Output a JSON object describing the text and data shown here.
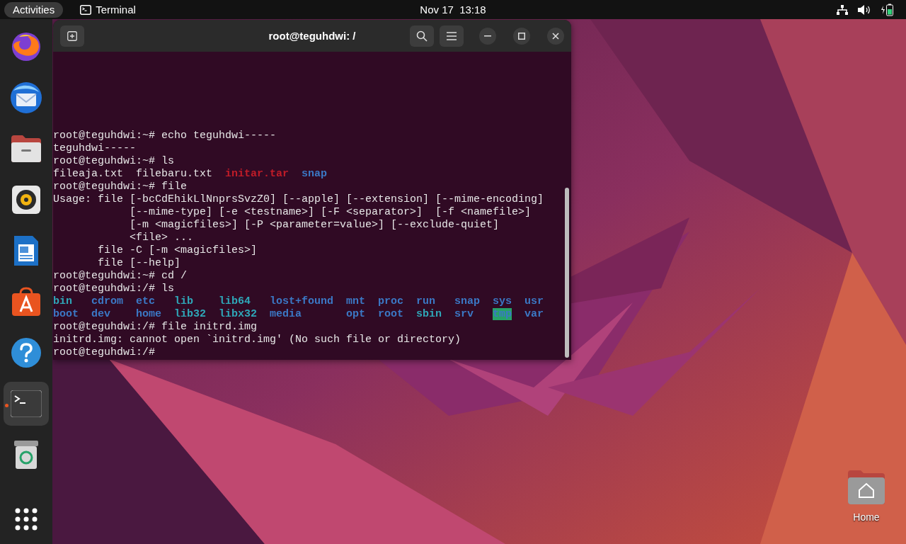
{
  "top_bar": {
    "activities": "Activities",
    "app_name": "Terminal",
    "clock": "Nov 17  13:18"
  },
  "dock": {
    "items": [
      {
        "kind": "firefox",
        "running": false
      },
      {
        "kind": "mail",
        "running": false
      },
      {
        "kind": "files",
        "running": false
      },
      {
        "kind": "music",
        "running": false
      },
      {
        "kind": "writer",
        "running": false
      },
      {
        "kind": "store",
        "running": false
      },
      {
        "kind": "help",
        "running": false
      },
      {
        "kind": "terminal",
        "running": true
      },
      {
        "kind": "trash",
        "running": false
      }
    ]
  },
  "terminal": {
    "title": "root@teguhdwi: /",
    "lines": [
      {
        "segments": [
          {
            "text": "root@teguhdwi:~# echo teguhdwi-----",
            "kind": "plain"
          }
        ]
      },
      {
        "segments": [
          {
            "text": "teguhdwi-----",
            "kind": "plain"
          }
        ]
      },
      {
        "segments": [
          {
            "text": "root@teguhdwi:~# ls",
            "kind": "plain"
          }
        ]
      },
      {
        "listing": [
          [
            {
              "text": "fileaja.txt",
              "kind": "plain"
            },
            {
              "text": "filebaru.txt",
              "kind": "plain"
            },
            {
              "text": "initar.tar",
              "kind": "archive"
            },
            {
              "text": "snap",
              "kind": "dir"
            }
          ]
        ]
      },
      {
        "segments": [
          {
            "text": "root@teguhdwi:~# file",
            "kind": "plain"
          }
        ]
      },
      {
        "segments": [
          {
            "text": "Usage: file [-bcCdEhikLlNnprsSvzZ0] [--apple] [--extension] [--mime-encoding]",
            "kind": "plain"
          }
        ]
      },
      {
        "segments": [
          {
            "text": "            [--mime-type] [-e <testname>] [-F <separator>]  [-f <namefile>]",
            "kind": "plain"
          }
        ]
      },
      {
        "segments": [
          {
            "text": "            [-m <magicfiles>] [-P <parameter=value>] [--exclude-quiet]",
            "kind": "plain"
          }
        ]
      },
      {
        "segments": [
          {
            "text": "            <file> ...",
            "kind": "plain"
          }
        ]
      },
      {
        "segments": [
          {
            "text": "       file -C [-m <magicfiles>]",
            "kind": "plain"
          }
        ]
      },
      {
        "segments": [
          {
            "text": "       file [--help]",
            "kind": "plain"
          }
        ]
      },
      {
        "segments": [
          {
            "text": "root@teguhdwi:~# cd /",
            "kind": "plain"
          }
        ]
      },
      {
        "segments": [
          {
            "text": "root@teguhdwi:/# ls",
            "kind": "plain"
          }
        ]
      },
      {
        "listing": [
          [
            {
              "text": "bin",
              "kind": "link"
            },
            {
              "text": "cdrom",
              "kind": "dir"
            },
            {
              "text": "etc",
              "kind": "dir"
            },
            {
              "text": "lib",
              "kind": "link"
            },
            {
              "text": "lib64",
              "kind": "link"
            },
            {
              "text": "lost+found",
              "kind": "dir"
            },
            {
              "text": "mnt",
              "kind": "dir"
            },
            {
              "text": "proc",
              "kind": "dir"
            },
            {
              "text": "run",
              "kind": "dir"
            },
            {
              "text": "snap",
              "kind": "dir"
            },
            {
              "text": "sys",
              "kind": "dir"
            },
            {
              "text": "usr",
              "kind": "dir"
            }
          ],
          [
            {
              "text": "boot",
              "kind": "dir"
            },
            {
              "text": "dev",
              "kind": "dir"
            },
            {
              "text": "home",
              "kind": "dir"
            },
            {
              "text": "lib32",
              "kind": "link"
            },
            {
              "text": "libx32",
              "kind": "link"
            },
            {
              "text": "media",
              "kind": "dir"
            },
            {
              "text": "opt",
              "kind": "dir"
            },
            {
              "text": "root",
              "kind": "dir"
            },
            {
              "text": "sbin",
              "kind": "link"
            },
            {
              "text": "srv",
              "kind": "dir"
            },
            {
              "text": "tmp",
              "kind": "sticky"
            },
            {
              "text": "var",
              "kind": "dir"
            }
          ]
        ]
      },
      {
        "segments": [
          {
            "text": "root@teguhdwi:/# file initrd.img",
            "kind": "plain"
          }
        ]
      },
      {
        "segments": [
          {
            "text": "initrd.img: cannot open `initrd.img' (No such file or directory)",
            "kind": "plain"
          }
        ]
      },
      {
        "segments": [
          {
            "text": "root@teguhdwi:/#",
            "kind": "plain"
          }
        ]
      }
    ]
  },
  "desktop_icons": [
    {
      "label": "Home"
    }
  ]
}
